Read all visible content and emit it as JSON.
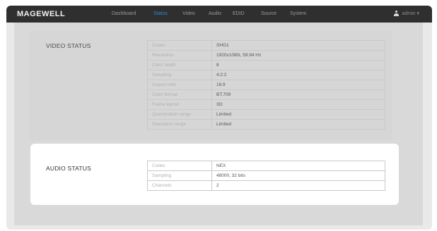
{
  "header": {
    "logo": "MAGEWELL",
    "nav": [
      {
        "label": "Dashboard",
        "active": false
      },
      {
        "label": "Status",
        "active": true
      },
      {
        "label": "Video",
        "active": false
      },
      {
        "label": "Audio",
        "active": false
      },
      {
        "label": "EDID",
        "active": false
      },
      {
        "label": "Source",
        "active": false
      },
      {
        "label": "System",
        "active": false
      }
    ],
    "user": "admin ▾"
  },
  "video_status": {
    "title": "VIDEO STATUS",
    "rows": [
      {
        "key": "Codec",
        "value": "SHG1"
      },
      {
        "key": "Resolution",
        "value": "1920x1080i, 59.94 Hz"
      },
      {
        "key": "Color depth",
        "value": "8"
      },
      {
        "key": "Sampling",
        "value": "4:2:2"
      },
      {
        "key": "Aspect ratio",
        "value": "16:9"
      },
      {
        "key": "Color format",
        "value": "BT.709"
      },
      {
        "key": "Frame layout",
        "value": "3G"
      },
      {
        "key": "Quantization range",
        "value": "Limited"
      },
      {
        "key": "Saturation range",
        "value": "Limited"
      }
    ]
  },
  "audio_status": {
    "title": "AUDIO STATUS",
    "rows": [
      {
        "key": "Codec",
        "value": "NEX"
      },
      {
        "key": "Sampling",
        "value": "48000, 32 bits"
      },
      {
        "key": "Channels",
        "value": "2"
      }
    ]
  },
  "colors": {
    "accent": "#2a8ad8",
    "topbar": "#2f2f2f",
    "dimmed_background": "#d9d9d9"
  }
}
